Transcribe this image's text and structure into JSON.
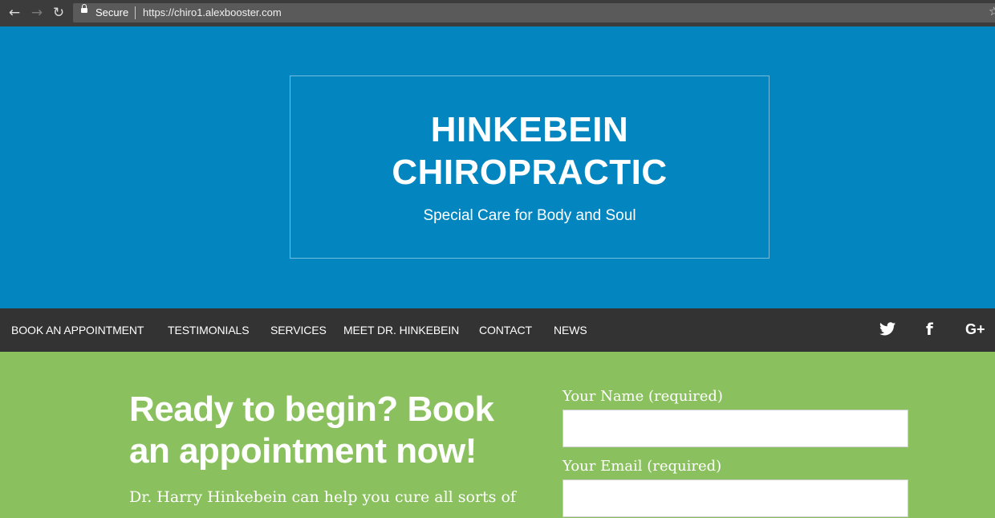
{
  "browser": {
    "back_glyph": "←",
    "forward_glyph": "→",
    "reload_glyph": "↻",
    "secure_label": "Secure",
    "url": "https://chiro1.alexbooster.com",
    "star_glyph": "☆"
  },
  "hero": {
    "title_line1": "HINKEBEIN",
    "title_line2": "CHIROPRACTIC",
    "tagline": "Special Care for Body and Soul"
  },
  "nav": {
    "items": [
      {
        "label": "BOOK AN APPOINTMENT"
      },
      {
        "label": "TESTIMONIALS"
      },
      {
        "label": "SERVICES"
      },
      {
        "label": "MEET DR. HINKEBEIN"
      },
      {
        "label": "CONTACT"
      },
      {
        "label": "NEWS"
      }
    ],
    "social": [
      {
        "icon": "twitter-icon"
      },
      {
        "icon": "facebook-icon",
        "glyph": "f"
      },
      {
        "icon": "google-plus-icon",
        "glyph": "G+"
      }
    ]
  },
  "booking": {
    "heading_line1": "Ready to begin? Book",
    "heading_line2": "an appointment now!",
    "intro": "Dr. Harry Hinkebein can help you cure all sorts of",
    "form": {
      "name_label": "Your Name (required)",
      "name_value": "",
      "email_label": "Your Email (required)",
      "email_value": ""
    }
  },
  "colors": {
    "hero_bg": "#0386c0",
    "nav_bg": "#333333",
    "booking_bg": "#8ac15e"
  }
}
